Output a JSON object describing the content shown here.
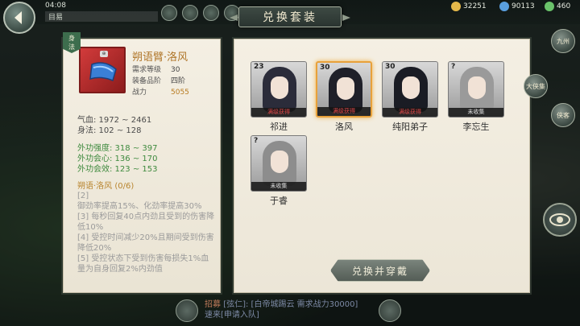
{
  "window": {
    "title": "兑换套装"
  },
  "status": {
    "time": "04:08",
    "channel": "目易",
    "currency": [
      {
        "value": "32251",
        "color": "#e5b84a"
      },
      {
        "value": "90113",
        "color": "#5aa0e0"
      },
      {
        "value": "460",
        "color": "#6ac36a"
      }
    ]
  },
  "detail": {
    "badge": [
      "身",
      "法"
    ],
    "item_name": "朔语臂·洛风",
    "gem_label": "⊕",
    "meta": [
      {
        "key": "需求等级",
        "value": "30"
      },
      {
        "key": "装备品阶",
        "value": "四阶"
      },
      {
        "key": "战力",
        "value": "5055"
      }
    ],
    "stats_basic": [
      "气血: 1972 ~ 2461",
      "身法: 102 ~ 128"
    ],
    "stats_green": [
      "外功强度: 318 ~ 397",
      "外功会心: 136 ~ 170",
      "外功会效: 123 ~ 153"
    ],
    "set_title": "朔语·洛风  (0/6)",
    "set_bonus": [
      "[2]",
      "御劲率提高15%、化劲率提高30%",
      "[3] 每秒回复40点内劲且受到的伤害降低10%",
      "[4] 受控时间减少20%且期间受到伤害降低20%",
      "[5] 受控状态下受到伤害每损失1%血量为自身回复2%内劲值"
    ]
  },
  "cards": [
    {
      "name": "祁进",
      "level": "23",
      "strip": "满级获得",
      "strip_red": true,
      "hair": "#2b2c3a",
      "selected": false
    },
    {
      "name": "洛风",
      "level": "30",
      "strip": "满级获得",
      "strip_red": true,
      "hair": "#1f2029",
      "selected": true
    },
    {
      "name": "纯阳弟子",
      "level": "30",
      "strip": "满级获得",
      "strip_red": true,
      "hair": "#1a1c24",
      "selected": false
    },
    {
      "name": "李忘生",
      "level": "?",
      "strip": "未收集",
      "strip_red": false,
      "hair": "#9a9a9a",
      "selected": false
    },
    {
      "name": "于睿",
      "level": "?",
      "strip": "未收集",
      "strip_red": false,
      "hair": "#8d8d8d",
      "selected": false
    }
  ],
  "redeem_button": "兑换并穿戴",
  "side_buttons": [
    "九州",
    "大侠集",
    "侠客"
  ],
  "chat": {
    "channel_tag": "招募",
    "text": "[弦仁]: [白帝城踢云 需求战力30000]速来[申请入队]"
  }
}
